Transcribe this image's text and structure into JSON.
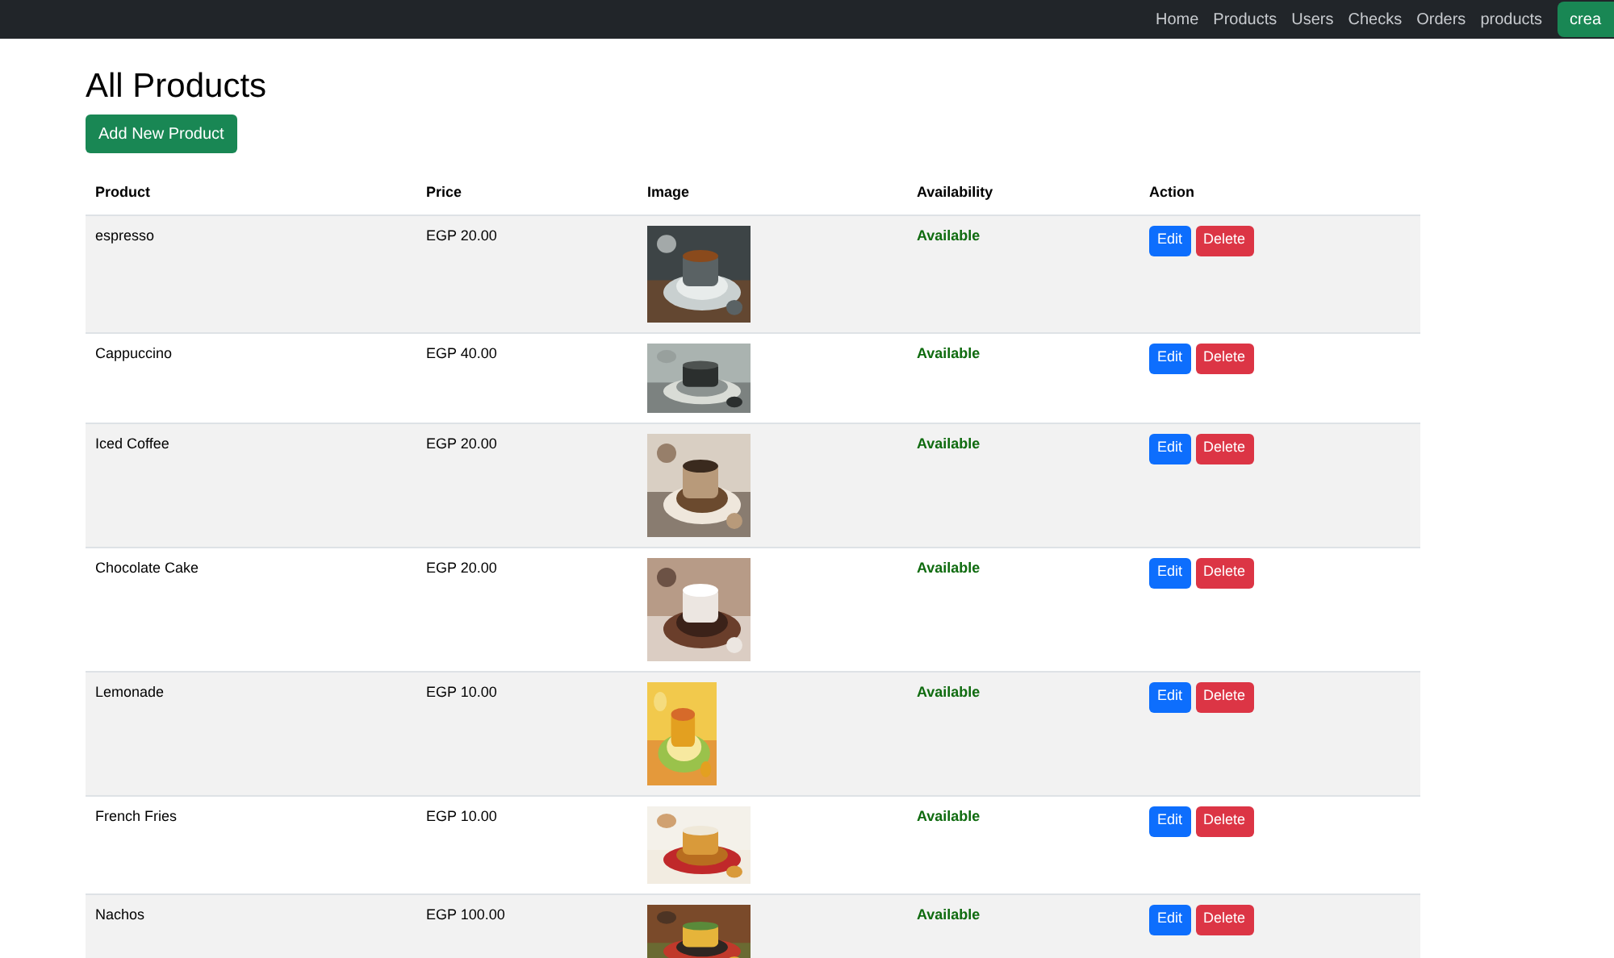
{
  "navbar": {
    "links": [
      "Home",
      "Products",
      "Users",
      "Checks",
      "Orders",
      "products"
    ],
    "button": "crea"
  },
  "title": "All Products",
  "add_button": "Add New Product",
  "table": {
    "columns": [
      "Product",
      "Price",
      "Image",
      "Availability",
      "Action"
    ],
    "rows": [
      {
        "product": "espresso",
        "price": "EGP 20.00",
        "availability": "Available",
        "edit": "Edit",
        "delete": "Delete"
      },
      {
        "product": "Cappuccino",
        "price": "EGP 40.00",
        "availability": "Available",
        "edit": "Edit",
        "delete": "Delete"
      },
      {
        "product": "Iced Coffee",
        "price": "EGP 20.00",
        "availability": "Available",
        "edit": "Edit",
        "delete": "Delete"
      },
      {
        "product": "Chocolate Cake",
        "price": "EGP 20.00",
        "availability": "Available",
        "edit": "Edit",
        "delete": "Delete"
      },
      {
        "product": "Lemonade",
        "price": "EGP 10.00",
        "availability": "Available",
        "edit": "Edit",
        "delete": "Delete"
      },
      {
        "product": "French Fries",
        "price": "EGP 10.00",
        "availability": "Available",
        "edit": "Edit",
        "delete": "Delete"
      },
      {
        "product": "Nachos",
        "price": "EGP 100.00",
        "availability": "Available",
        "edit": "Edit",
        "delete": "Delete"
      }
    ]
  }
}
